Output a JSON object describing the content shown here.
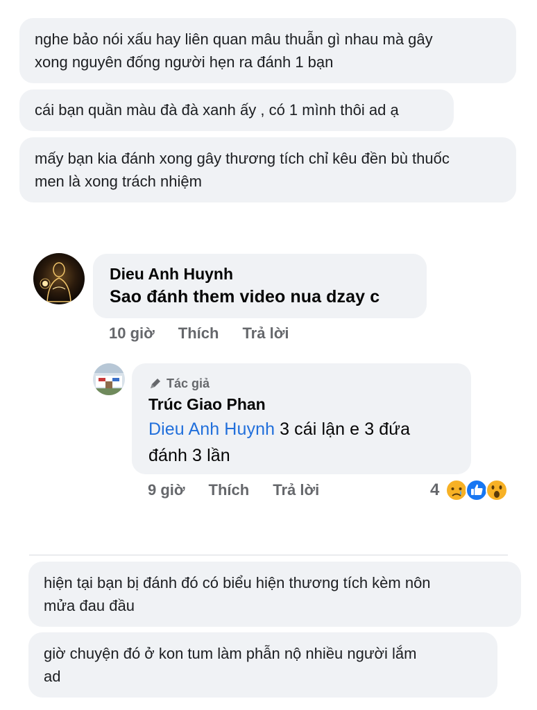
{
  "top_messages": [
    {
      "line1": "nghe bảo nói xấu hay liên quan mâu thuẫn gì nhau mà gây",
      "line2": "xong nguyên đống người hẹn ra đánh 1 bạn"
    },
    {
      "line1": "cái bạn quần màu đà đà xanh ấy , có 1 mình thôi ad ạ",
      "line2": ""
    },
    {
      "line1": "mấy bạn kia đánh xong gây thương tích chỉ kêu đền bù thuốc",
      "line2": "men là xong trách nhiệm"
    }
  ],
  "comment": {
    "author": "Dieu Anh Huynh",
    "text": "Sao đánh them video nua dzay c",
    "time": "10 giờ",
    "like_label": "Thích",
    "reply_label": "Trả lời"
  },
  "reply": {
    "badge": "Tác giả",
    "author": "Trúc Giao Phan",
    "mention": "Dieu Anh Huynh",
    "text_rest": " 3 cái lận e 3 đứa",
    "text_line2": "đánh 3 lần",
    "time": "9 giờ",
    "like_label": "Thích",
    "reply_label": "Trả lời",
    "reaction_count": "4",
    "reactions": [
      "sad-emoji-icon",
      "like-icon",
      "wow-emoji-icon"
    ]
  },
  "bottom_messages": [
    {
      "line1": "hiện tại bạn bị đánh đó có biểu hiện thương tích kèm nôn",
      "line2": "mửa đau đầu"
    },
    {
      "line1": "giờ chuyện đó ở kon tum làm phẫn nộ nhiều người lắm",
      "line2": "ad"
    }
  ],
  "colors": {
    "bubble": "#f0f2f5",
    "mention": "#216fdb",
    "meta": "#65676b",
    "like_blue": "#1877f2",
    "emoji_yellow": "#f7b125"
  }
}
